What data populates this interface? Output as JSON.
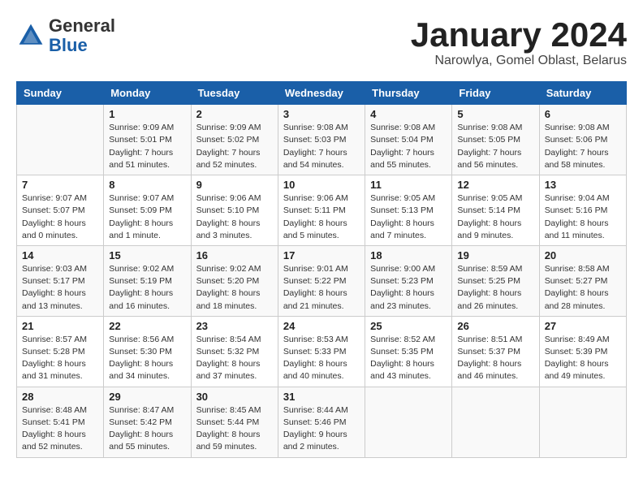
{
  "header": {
    "logo_line1": "General",
    "logo_line2": "Blue",
    "month_title": "January 2024",
    "location": "Narowlya, Gomel Oblast, Belarus"
  },
  "days_of_week": [
    "Sunday",
    "Monday",
    "Tuesday",
    "Wednesday",
    "Thursday",
    "Friday",
    "Saturday"
  ],
  "weeks": [
    [
      {
        "day": "",
        "info": ""
      },
      {
        "day": "1",
        "info": "Sunrise: 9:09 AM\nSunset: 5:01 PM\nDaylight: 7 hours\nand 51 minutes."
      },
      {
        "day": "2",
        "info": "Sunrise: 9:09 AM\nSunset: 5:02 PM\nDaylight: 7 hours\nand 52 minutes."
      },
      {
        "day": "3",
        "info": "Sunrise: 9:08 AM\nSunset: 5:03 PM\nDaylight: 7 hours\nand 54 minutes."
      },
      {
        "day": "4",
        "info": "Sunrise: 9:08 AM\nSunset: 5:04 PM\nDaylight: 7 hours\nand 55 minutes."
      },
      {
        "day": "5",
        "info": "Sunrise: 9:08 AM\nSunset: 5:05 PM\nDaylight: 7 hours\nand 56 minutes."
      },
      {
        "day": "6",
        "info": "Sunrise: 9:08 AM\nSunset: 5:06 PM\nDaylight: 7 hours\nand 58 minutes."
      }
    ],
    [
      {
        "day": "7",
        "info": "Sunrise: 9:07 AM\nSunset: 5:07 PM\nDaylight: 8 hours\nand 0 minutes."
      },
      {
        "day": "8",
        "info": "Sunrise: 9:07 AM\nSunset: 5:09 PM\nDaylight: 8 hours\nand 1 minute."
      },
      {
        "day": "9",
        "info": "Sunrise: 9:06 AM\nSunset: 5:10 PM\nDaylight: 8 hours\nand 3 minutes."
      },
      {
        "day": "10",
        "info": "Sunrise: 9:06 AM\nSunset: 5:11 PM\nDaylight: 8 hours\nand 5 minutes."
      },
      {
        "day": "11",
        "info": "Sunrise: 9:05 AM\nSunset: 5:13 PM\nDaylight: 8 hours\nand 7 minutes."
      },
      {
        "day": "12",
        "info": "Sunrise: 9:05 AM\nSunset: 5:14 PM\nDaylight: 8 hours\nand 9 minutes."
      },
      {
        "day": "13",
        "info": "Sunrise: 9:04 AM\nSunset: 5:16 PM\nDaylight: 8 hours\nand 11 minutes."
      }
    ],
    [
      {
        "day": "14",
        "info": "Sunrise: 9:03 AM\nSunset: 5:17 PM\nDaylight: 8 hours\nand 13 minutes."
      },
      {
        "day": "15",
        "info": "Sunrise: 9:02 AM\nSunset: 5:19 PM\nDaylight: 8 hours\nand 16 minutes."
      },
      {
        "day": "16",
        "info": "Sunrise: 9:02 AM\nSunset: 5:20 PM\nDaylight: 8 hours\nand 18 minutes."
      },
      {
        "day": "17",
        "info": "Sunrise: 9:01 AM\nSunset: 5:22 PM\nDaylight: 8 hours\nand 21 minutes."
      },
      {
        "day": "18",
        "info": "Sunrise: 9:00 AM\nSunset: 5:23 PM\nDaylight: 8 hours\nand 23 minutes."
      },
      {
        "day": "19",
        "info": "Sunrise: 8:59 AM\nSunset: 5:25 PM\nDaylight: 8 hours\nand 26 minutes."
      },
      {
        "day": "20",
        "info": "Sunrise: 8:58 AM\nSunset: 5:27 PM\nDaylight: 8 hours\nand 28 minutes."
      }
    ],
    [
      {
        "day": "21",
        "info": "Sunrise: 8:57 AM\nSunset: 5:28 PM\nDaylight: 8 hours\nand 31 minutes."
      },
      {
        "day": "22",
        "info": "Sunrise: 8:56 AM\nSunset: 5:30 PM\nDaylight: 8 hours\nand 34 minutes."
      },
      {
        "day": "23",
        "info": "Sunrise: 8:54 AM\nSunset: 5:32 PM\nDaylight: 8 hours\nand 37 minutes."
      },
      {
        "day": "24",
        "info": "Sunrise: 8:53 AM\nSunset: 5:33 PM\nDaylight: 8 hours\nand 40 minutes."
      },
      {
        "day": "25",
        "info": "Sunrise: 8:52 AM\nSunset: 5:35 PM\nDaylight: 8 hours\nand 43 minutes."
      },
      {
        "day": "26",
        "info": "Sunrise: 8:51 AM\nSunset: 5:37 PM\nDaylight: 8 hours\nand 46 minutes."
      },
      {
        "day": "27",
        "info": "Sunrise: 8:49 AM\nSunset: 5:39 PM\nDaylight: 8 hours\nand 49 minutes."
      }
    ],
    [
      {
        "day": "28",
        "info": "Sunrise: 8:48 AM\nSunset: 5:41 PM\nDaylight: 8 hours\nand 52 minutes."
      },
      {
        "day": "29",
        "info": "Sunrise: 8:47 AM\nSunset: 5:42 PM\nDaylight: 8 hours\nand 55 minutes."
      },
      {
        "day": "30",
        "info": "Sunrise: 8:45 AM\nSunset: 5:44 PM\nDaylight: 8 hours\nand 59 minutes."
      },
      {
        "day": "31",
        "info": "Sunrise: 8:44 AM\nSunset: 5:46 PM\nDaylight: 9 hours\nand 2 minutes."
      },
      {
        "day": "",
        "info": ""
      },
      {
        "day": "",
        "info": ""
      },
      {
        "day": "",
        "info": ""
      }
    ]
  ]
}
